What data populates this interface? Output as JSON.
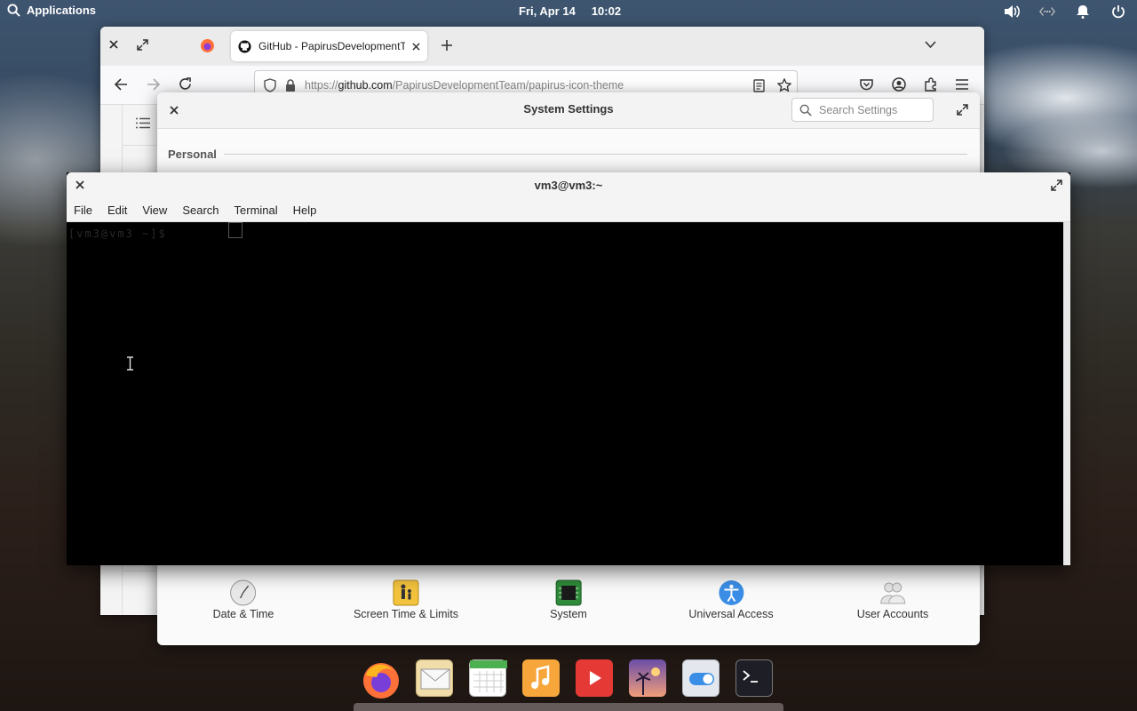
{
  "topbar": {
    "applications_label": "Applications",
    "date": "Fri, Apr 14",
    "time": "10:02"
  },
  "firefox": {
    "tab_title": "GitHub - PapirusDevelopmentTeam",
    "url_prefix": "https://",
    "url_domain": "github.com",
    "url_path": "/PapirusDevelopmentTeam/papirus-icon-theme"
  },
  "settings": {
    "title": "System Settings",
    "search_placeholder": "Search Settings",
    "section_personal": "Personal",
    "items": [
      {
        "label": "Date & Time",
        "icon": "clock-icon"
      },
      {
        "label": "Screen Time & Limits",
        "icon": "parental-controls-icon"
      },
      {
        "label": "System",
        "icon": "chip-icon"
      },
      {
        "label": "Universal Access",
        "icon": "accessibility-icon"
      },
      {
        "label": "User Accounts",
        "icon": "users-icon"
      }
    ]
  },
  "terminal": {
    "title": "vm3@vm3:~",
    "menu": [
      "File",
      "Edit",
      "View",
      "Search",
      "Terminal",
      "Help"
    ],
    "prompt": "[vm3@vm3 ~]$"
  },
  "dock": {
    "apps": [
      "firefox-icon",
      "mail-icon",
      "calendar-icon",
      "music-icon",
      "videos-icon",
      "photos-icon",
      "settings-toggle-icon",
      "terminal-icon"
    ]
  },
  "colors": {
    "terminal_bg": "#000000",
    "accessibility_blue": "#3b8ee6",
    "system_green": "#2f8a3a"
  }
}
